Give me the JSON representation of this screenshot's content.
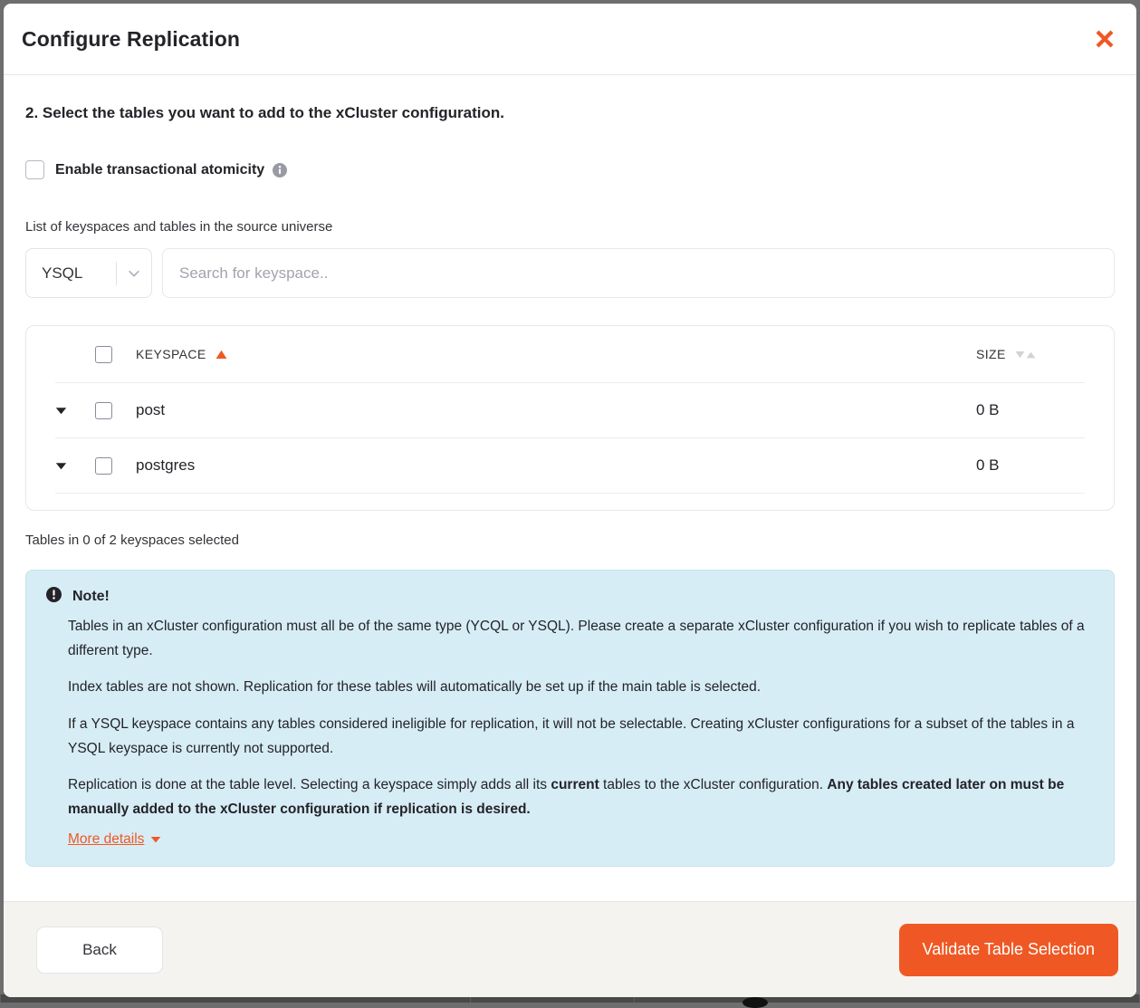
{
  "window": {
    "title": "Configure Replication",
    "close_icon": "close-x-icon"
  },
  "body": {
    "step_title": "2. Select the tables you want to add to the xCluster configuration.",
    "atomicity": {
      "label": "Enable transactional atomicity",
      "checked": false,
      "info_icon": "info-circle-icon"
    },
    "list_label": "List of keyspaces and tables in the source universe",
    "search": {
      "type_value": "YSQL",
      "type_chevron_icon": "chevron-down-icon",
      "placeholder": "Search for keyspace.."
    },
    "table": {
      "columns": [
        {
          "label": "KEYSPACE",
          "sort": "asc",
          "sort_icon": "triangle-up-icon"
        },
        {
          "label": "SIZE",
          "sort": "none",
          "sort_icon": "triangle-updown-icon"
        }
      ],
      "rows": [
        {
          "expand_icon": "caret-down-icon",
          "checked": false,
          "keyspace": "post",
          "size": "0 B"
        },
        {
          "expand_icon": "caret-down-icon",
          "checked": false,
          "keyspace": "postgres",
          "size": "0 B"
        }
      ]
    },
    "selected_count": "Tables in 0 of 2 keyspaces selected",
    "note": {
      "icon": "exclamation-circle-icon",
      "title": "Note!",
      "p1": "Tables in an xCluster configuration must all be of the same type (YCQL or YSQL). Please create a separate xCluster configuration if you wish to replicate tables of a different type.",
      "p2": "Index tables are not shown. Replication for these tables will automatically be set up if the main table is selected.",
      "p3": "If a YSQL keyspace contains any tables considered ineligible for replication, it will not be selectable. Creating xCluster configurations for a subset of the tables in a YSQL keyspace is currently not supported.",
      "p4_a": "Replication is done at the table level. Selecting a keyspace simply adds all its ",
      "p4_b": "current",
      "p4_c": " tables to the xCluster configuration. ",
      "p4_d": "Any tables created later on must be manually added to the xCluster configuration if replication is desired.",
      "more_details": "More details",
      "more_details_icon": "caret-down-icon"
    }
  },
  "footer": {
    "back_label": "Back",
    "validate_label": "Validate Table Selection"
  },
  "colors": {
    "accent": "#ef5824",
    "note_bg": "#d7edf5",
    "footer_bg": "#f4f3ef",
    "text": "#232329"
  }
}
